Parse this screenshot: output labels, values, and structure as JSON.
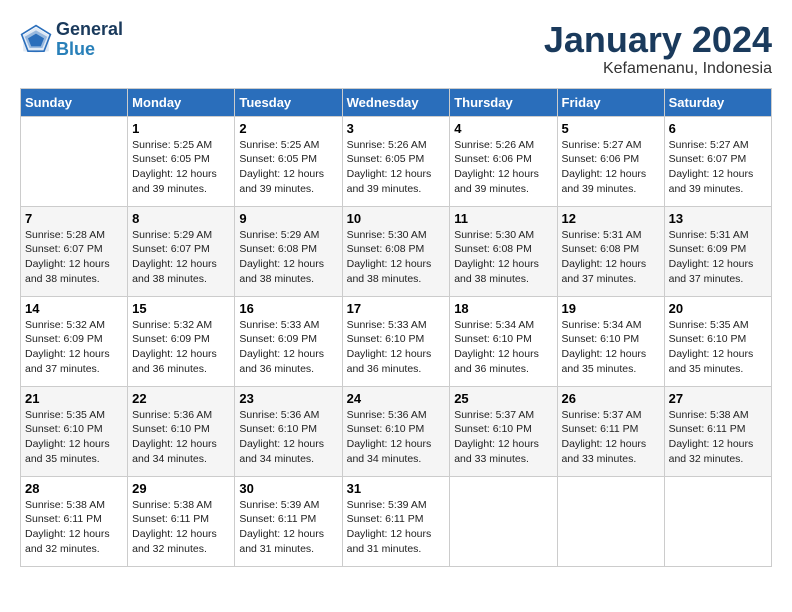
{
  "header": {
    "logo_line1": "General",
    "logo_line2": "Blue",
    "month_title": "January 2024",
    "location": "Kefamenanu, Indonesia"
  },
  "weekdays": [
    "Sunday",
    "Monday",
    "Tuesday",
    "Wednesday",
    "Thursday",
    "Friday",
    "Saturday"
  ],
  "weeks": [
    [
      {
        "day": "",
        "info": ""
      },
      {
        "day": "1",
        "info": "Sunrise: 5:25 AM\nSunset: 6:05 PM\nDaylight: 12 hours\nand 39 minutes."
      },
      {
        "day": "2",
        "info": "Sunrise: 5:25 AM\nSunset: 6:05 PM\nDaylight: 12 hours\nand 39 minutes."
      },
      {
        "day": "3",
        "info": "Sunrise: 5:26 AM\nSunset: 6:05 PM\nDaylight: 12 hours\nand 39 minutes."
      },
      {
        "day": "4",
        "info": "Sunrise: 5:26 AM\nSunset: 6:06 PM\nDaylight: 12 hours\nand 39 minutes."
      },
      {
        "day": "5",
        "info": "Sunrise: 5:27 AM\nSunset: 6:06 PM\nDaylight: 12 hours\nand 39 minutes."
      },
      {
        "day": "6",
        "info": "Sunrise: 5:27 AM\nSunset: 6:07 PM\nDaylight: 12 hours\nand 39 minutes."
      }
    ],
    [
      {
        "day": "7",
        "info": "Sunrise: 5:28 AM\nSunset: 6:07 PM\nDaylight: 12 hours\nand 38 minutes."
      },
      {
        "day": "8",
        "info": "Sunrise: 5:29 AM\nSunset: 6:07 PM\nDaylight: 12 hours\nand 38 minutes."
      },
      {
        "day": "9",
        "info": "Sunrise: 5:29 AM\nSunset: 6:08 PM\nDaylight: 12 hours\nand 38 minutes."
      },
      {
        "day": "10",
        "info": "Sunrise: 5:30 AM\nSunset: 6:08 PM\nDaylight: 12 hours\nand 38 minutes."
      },
      {
        "day": "11",
        "info": "Sunrise: 5:30 AM\nSunset: 6:08 PM\nDaylight: 12 hours\nand 38 minutes."
      },
      {
        "day": "12",
        "info": "Sunrise: 5:31 AM\nSunset: 6:08 PM\nDaylight: 12 hours\nand 37 minutes."
      },
      {
        "day": "13",
        "info": "Sunrise: 5:31 AM\nSunset: 6:09 PM\nDaylight: 12 hours\nand 37 minutes."
      }
    ],
    [
      {
        "day": "14",
        "info": "Sunrise: 5:32 AM\nSunset: 6:09 PM\nDaylight: 12 hours\nand 37 minutes."
      },
      {
        "day": "15",
        "info": "Sunrise: 5:32 AM\nSunset: 6:09 PM\nDaylight: 12 hours\nand 36 minutes."
      },
      {
        "day": "16",
        "info": "Sunrise: 5:33 AM\nSunset: 6:09 PM\nDaylight: 12 hours\nand 36 minutes."
      },
      {
        "day": "17",
        "info": "Sunrise: 5:33 AM\nSunset: 6:10 PM\nDaylight: 12 hours\nand 36 minutes."
      },
      {
        "day": "18",
        "info": "Sunrise: 5:34 AM\nSunset: 6:10 PM\nDaylight: 12 hours\nand 36 minutes."
      },
      {
        "day": "19",
        "info": "Sunrise: 5:34 AM\nSunset: 6:10 PM\nDaylight: 12 hours\nand 35 minutes."
      },
      {
        "day": "20",
        "info": "Sunrise: 5:35 AM\nSunset: 6:10 PM\nDaylight: 12 hours\nand 35 minutes."
      }
    ],
    [
      {
        "day": "21",
        "info": "Sunrise: 5:35 AM\nSunset: 6:10 PM\nDaylight: 12 hours\nand 35 minutes."
      },
      {
        "day": "22",
        "info": "Sunrise: 5:36 AM\nSunset: 6:10 PM\nDaylight: 12 hours\nand 34 minutes."
      },
      {
        "day": "23",
        "info": "Sunrise: 5:36 AM\nSunset: 6:10 PM\nDaylight: 12 hours\nand 34 minutes."
      },
      {
        "day": "24",
        "info": "Sunrise: 5:36 AM\nSunset: 6:10 PM\nDaylight: 12 hours\nand 34 minutes."
      },
      {
        "day": "25",
        "info": "Sunrise: 5:37 AM\nSunset: 6:10 PM\nDaylight: 12 hours\nand 33 minutes."
      },
      {
        "day": "26",
        "info": "Sunrise: 5:37 AM\nSunset: 6:11 PM\nDaylight: 12 hours\nand 33 minutes."
      },
      {
        "day": "27",
        "info": "Sunrise: 5:38 AM\nSunset: 6:11 PM\nDaylight: 12 hours\nand 32 minutes."
      }
    ],
    [
      {
        "day": "28",
        "info": "Sunrise: 5:38 AM\nSunset: 6:11 PM\nDaylight: 12 hours\nand 32 minutes."
      },
      {
        "day": "29",
        "info": "Sunrise: 5:38 AM\nSunset: 6:11 PM\nDaylight: 12 hours\nand 32 minutes."
      },
      {
        "day": "30",
        "info": "Sunrise: 5:39 AM\nSunset: 6:11 PM\nDaylight: 12 hours\nand 31 minutes."
      },
      {
        "day": "31",
        "info": "Sunrise: 5:39 AM\nSunset: 6:11 PM\nDaylight: 12 hours\nand 31 minutes."
      },
      {
        "day": "",
        "info": ""
      },
      {
        "day": "",
        "info": ""
      },
      {
        "day": "",
        "info": ""
      }
    ]
  ]
}
